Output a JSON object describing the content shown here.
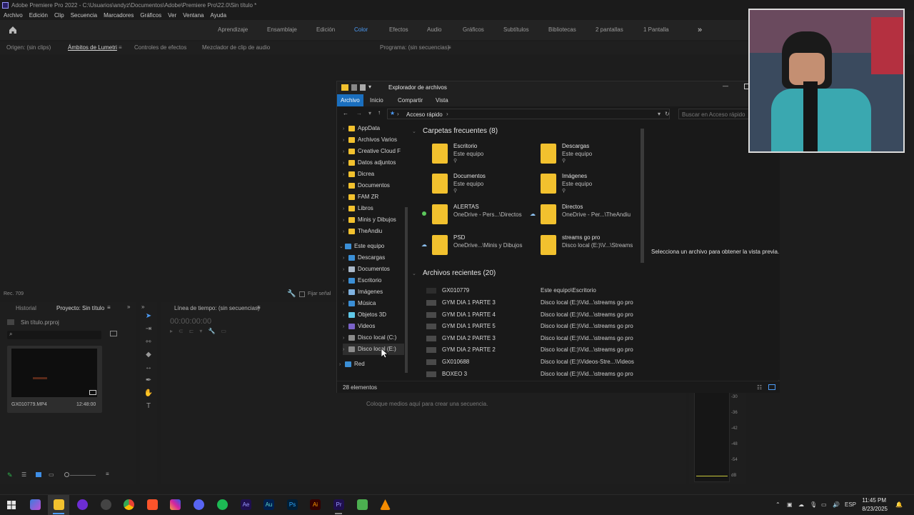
{
  "app": {
    "title": "Adobe Premiere Pro 2022 - C:\\Usuarios\\andyz\\Documentos\\Adobe\\Premiere Pro\\22.0\\Sin título *",
    "menu": [
      "Archivo",
      "Edición",
      "Clip",
      "Secuencia",
      "Marcadores",
      "Gráficos",
      "Ver",
      "Ventana",
      "Ayuda"
    ],
    "workspaces": [
      "Aprendizaje",
      "Ensamblaje",
      "Edición",
      "Color",
      "Efectos",
      "Audio",
      "Gráficos",
      "Subtítulos",
      "Bibliotecas",
      "2 pantallas",
      "1 Pantalla"
    ],
    "active_workspace": "Color",
    "more_workspaces": "»"
  },
  "panels": {
    "source_tabs": [
      "Origen: (sin clips)",
      "Ámbitos de Lumetri",
      "Controles de efectos",
      "Mezclador de clip de audio"
    ],
    "active_source_tab": "Ámbitos de Lumetri",
    "program_tab": "Programa: (sin secuencias)",
    "rec_label": "Rec. 709",
    "fix_signal": "Fijar señal",
    "project_tabs": [
      "Historial",
      "Proyecto: Sin título"
    ],
    "project_file": "Sin título.prproj",
    "clip_name": "GX010779.MP4",
    "clip_duration": "12:48:00",
    "timeline_tab": "Línea de tiempo: (sin secuencias)",
    "timecode": "00:00:00:00",
    "timeline_hint": "Coloque medios aquí para crear una secuencia.",
    "meter_ticks": [
      "-30",
      "-36",
      "-42",
      "-48",
      "-54",
      "dB"
    ]
  },
  "explorer": {
    "title": "Explorador de archivos",
    "ribbon": [
      "Archivo",
      "Inicio",
      "Compartir",
      "Vista"
    ],
    "address": "Acceso rápido",
    "search_placeholder": "Buscar en Acceso rápido",
    "nav_quick": [
      "AppData",
      "Archivos Varios",
      "Creative Cloud F",
      "Datos adjuntos",
      "Dicrea",
      "Documentos",
      "FAM ZR",
      "Libros",
      "Minis y Dibujos",
      "TheAndiu"
    ],
    "nav_pc_label": "Este equipo",
    "nav_pc": [
      "Descargas",
      "Documentos",
      "Escritorio",
      "Imágenes",
      "Música",
      "Objetos 3D",
      "Videos",
      "Disco local (C:)",
      "Disco local (E:)"
    ],
    "nav_net": "Red",
    "freq_header": "Carpetas frecuentes (8)",
    "frequent": [
      {
        "name": "Escritorio",
        "sub": "Este equipo"
      },
      {
        "name": "Descargas",
        "sub": "Este equipo"
      },
      {
        "name": "Documentos",
        "sub": "Este equipo"
      },
      {
        "name": "Imágenes",
        "sub": "Este equipo"
      },
      {
        "name": "ALERTAS",
        "sub": "OneDrive - Pers...\\Directos"
      },
      {
        "name": "Directos",
        "sub": "OneDrive - Per...\\TheAndiu"
      },
      {
        "name": "PSD",
        "sub": "OneDrive...\\Minis y Dibujos"
      },
      {
        "name": "streams go pro",
        "sub": "Disco local (E:)\\V...\\Streams"
      }
    ],
    "recent_header": "Archivos recientes (20)",
    "recent": [
      {
        "name": "GX010779",
        "loc": "Este equipo\\Escritorio"
      },
      {
        "name": "GYM DIA 1 PARTE 3",
        "loc": "Disco local (E:)\\Vid...\\streams go pro"
      },
      {
        "name": "GYM DIA 1 PARTE 4",
        "loc": "Disco local (E:)\\Vid...\\streams go pro"
      },
      {
        "name": "GYM DIA 1 PARTE 5",
        "loc": "Disco local (E:)\\Vid...\\streams go pro"
      },
      {
        "name": "GYM DIA 2 PARTE 3",
        "loc": "Disco local (E:)\\Vid...\\streams go pro"
      },
      {
        "name": "GYM DIA 2 PARTE 2",
        "loc": "Disco local (E:)\\Vid...\\streams go pro"
      },
      {
        "name": "GX010688",
        "loc": "Disco local (E:)\\Videos-Stre...\\Videos"
      },
      {
        "name": "BOXEO 3",
        "loc": "Disco local (E:)\\Vid...\\streams go pro"
      }
    ],
    "preview_text": "Selecciona un archivo para obtener la vista previa.",
    "status": "28 elementos"
  },
  "taskbar": {
    "lang": "ESP",
    "time": "11:45 PM",
    "date": "8/23/2025",
    "apps": [
      "Ae",
      "Au",
      "Ps",
      "Ai",
      "Pr"
    ]
  },
  "colors": {
    "accent": "#4c9bf5",
    "folder": "#f2c12e",
    "ribbon_active": "#1a6fbf"
  }
}
